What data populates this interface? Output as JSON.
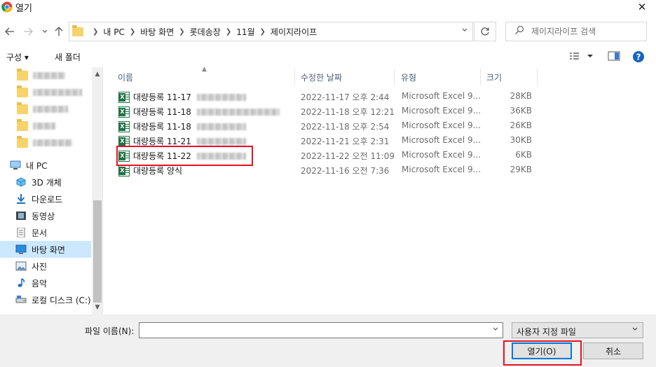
{
  "window": {
    "title": "열기",
    "close_glyph": "✕"
  },
  "address": {
    "crumbs": [
      "내 PC",
      "바탕 화면",
      "롯데송장",
      "11월",
      "제이지라이프"
    ],
    "search_placeholder": "제이지라이프 검색"
  },
  "toolbar": {
    "organize": "구성 ▾",
    "new_folder": "새 폴더"
  },
  "nav": {
    "items": [
      {
        "label": "내 PC",
        "icon": "pc-icon"
      },
      {
        "label": "3D 개체",
        "icon": "3d-objects-icon"
      },
      {
        "label": "다운로드",
        "icon": "download-icon"
      },
      {
        "label": "동영상",
        "icon": "video-icon"
      },
      {
        "label": "문서",
        "icon": "document-icon"
      },
      {
        "label": "바탕 화면",
        "icon": "desktop-icon",
        "selected": true
      },
      {
        "label": "사진",
        "icon": "pictures-icon"
      },
      {
        "label": "음악",
        "icon": "music-icon"
      },
      {
        "label": "로컬 디스크 (C:)",
        "icon": "drive-icon"
      }
    ]
  },
  "columns": {
    "name": "이름",
    "modified": "수정한 날짜",
    "type": "유형",
    "size": "크기"
  },
  "files": [
    {
      "name": "대량등록 11-17",
      "date": "2022-11-17 오후 2:44",
      "type": "Microsoft Excel 9...",
      "size": "28KB"
    },
    {
      "name": "대량등록 11-18",
      "date": "2022-11-18 오후 12:21",
      "type": "Microsoft Excel 9...",
      "size": "36KB"
    },
    {
      "name": "대량등록 11-18",
      "date": "2022-11-18 오후 2:54",
      "type": "Microsoft Excel 9...",
      "size": "26KB"
    },
    {
      "name": "대량등록 11-21",
      "date": "2022-11-21 오후 2:31",
      "type": "Microsoft Excel 9...",
      "size": "30KB"
    },
    {
      "name": "대량등록 11-22",
      "date": "2022-11-22 오전 11:09",
      "type": "Microsoft Excel 9...",
      "size": "6KB"
    },
    {
      "name": "대량등록 양식",
      "date": "2022-11-16 오전 7:36",
      "type": "Microsoft Excel 9...",
      "size": "29KB"
    }
  ],
  "bottom": {
    "filename_label": "파일 이름(N):",
    "filename_value": "",
    "filter": "사용자 지정 파일",
    "open": "열기(O)",
    "cancel": "취소"
  }
}
